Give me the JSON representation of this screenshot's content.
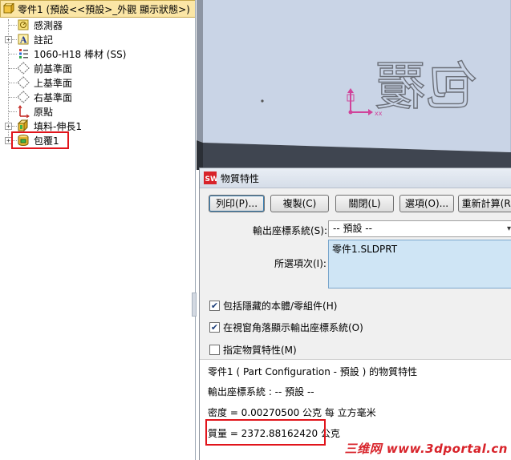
{
  "tree": {
    "root_label": "零件1 (預設<<預設>_外觀 顯示狀態>)",
    "items": [
      {
        "label": "感測器",
        "icon": "sensor-icon"
      },
      {
        "label": "註記",
        "icon": "annotation-icon"
      },
      {
        "label": "1060-H18 棒材 (SS)",
        "icon": "material-icon"
      },
      {
        "label": "前基準面",
        "icon": "plane-icon"
      },
      {
        "label": "上基準面",
        "icon": "plane-icon"
      },
      {
        "label": "右基準面",
        "icon": "plane-icon"
      },
      {
        "label": "原點",
        "icon": "origin-icon"
      },
      {
        "label": "填料-伸長1",
        "icon": "extrude-icon"
      },
      {
        "label": "包覆1",
        "icon": "wrap-icon"
      }
    ]
  },
  "viewport": {
    "embossed_text": "包覆"
  },
  "dialog": {
    "title": "物質特性",
    "buttons": {
      "print": "列印(P)...",
      "copy": "複製(C)",
      "close": "關閉(L)",
      "options": "選項(O)...",
      "recalculate": "重新計算(R)"
    },
    "coord_system_label": "輸出座標系統(S):",
    "coord_system_value": "-- 預設 --",
    "selected_items_label": "所選項次(I):",
    "selected_items_value": "零件1.SLDPRT",
    "checkboxes": [
      {
        "label": "包括隱藏的本體/零組件(H)",
        "checked": true
      },
      {
        "label": "在視窗角落顯示輸出座標系統(O)",
        "checked": true
      },
      {
        "label": "指定物質特性(M)",
        "checked": false
      }
    ],
    "results": {
      "heading": "零件1 ( Part Configuration - 預設 ) 的物質特性",
      "coord_line": "輸出座標系統 : -- 預設 --",
      "density_line": "密度 = 0.00270500 公克 每  立方毫米",
      "mass_line": "質量 = 2372.88162420 公克"
    }
  },
  "watermark": "三维网 www.3dportal.cn",
  "colors": {
    "highlight_box": "#e1141b",
    "tree_root_bg": "#fbe6a6",
    "selection_bg": "#cfe5f5",
    "model_face": "#c9d4e6"
  }
}
